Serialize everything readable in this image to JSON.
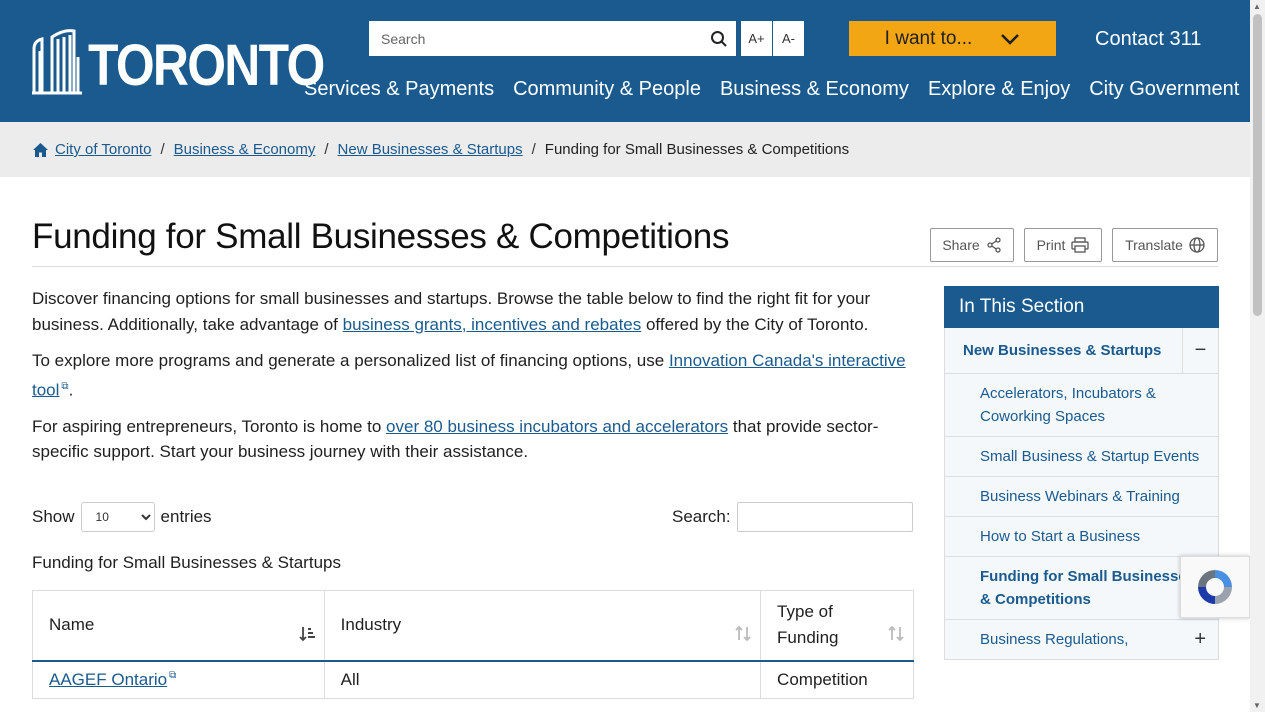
{
  "header": {
    "logo_text": "TORONTO",
    "search_placeholder": "Search",
    "font_increase": "A+",
    "font_decrease": "A-",
    "i_want_to": "I want to...",
    "contact": "Contact 311",
    "nav": [
      "Services & Payments",
      "Community & People",
      "Business & Economy",
      "Explore & Enjoy",
      "City Government"
    ]
  },
  "breadcrumb": {
    "items": [
      "City of Toronto",
      "Business & Economy",
      "New Businesses & Startups"
    ],
    "current": "Funding for Small Businesses & Competitions"
  },
  "page": {
    "title": "Funding for Small Businesses & Competitions",
    "share": "Share",
    "print": "Print",
    "translate": "Translate"
  },
  "content": {
    "p1_before": "Discover financing options for small businesses and startups. Browse the table below to find the right fit for your business. Additionally, take advantage of ",
    "p1_link": "business grants, incentives and rebates",
    "p1_after": " offered by the City of Toronto.",
    "p2_before": "To explore more programs and generate a personalized list of financing options, use ",
    "p2_link": "Innovation Canada's interactive tool",
    "p2_after": ".",
    "p3_before": "For aspiring entrepreneurs, Toronto is home to ",
    "p3_link": "over 80 business incubators and accelerators",
    "p3_after": " that provide sector-specific support. Start your business journey with their assistance."
  },
  "table_controls": {
    "show": "Show",
    "entries_value": "10",
    "entries": "entries",
    "search_label": "Search:"
  },
  "table": {
    "caption": "Funding for Small Businesses & Startups",
    "headers": [
      "Name",
      "Industry",
      "Type of Funding"
    ],
    "rows": [
      {
        "name": "AAGEF Ontario",
        "industry": "All",
        "type": "Competition"
      }
    ]
  },
  "sidebar": {
    "heading": "In This Section",
    "parent": "New Businesses & Startups",
    "items": [
      "Accelerators, Incubators & Coworking Spaces",
      "Small Business & Startup Events",
      "Business Webinars & Training",
      "How to Start a Business",
      "Funding for Small Businesses & Competitions",
      "Business Regulations,"
    ]
  },
  "colors": {
    "brand_blue": "#1a5a8e",
    "accent_orange": "#f3a613"
  }
}
